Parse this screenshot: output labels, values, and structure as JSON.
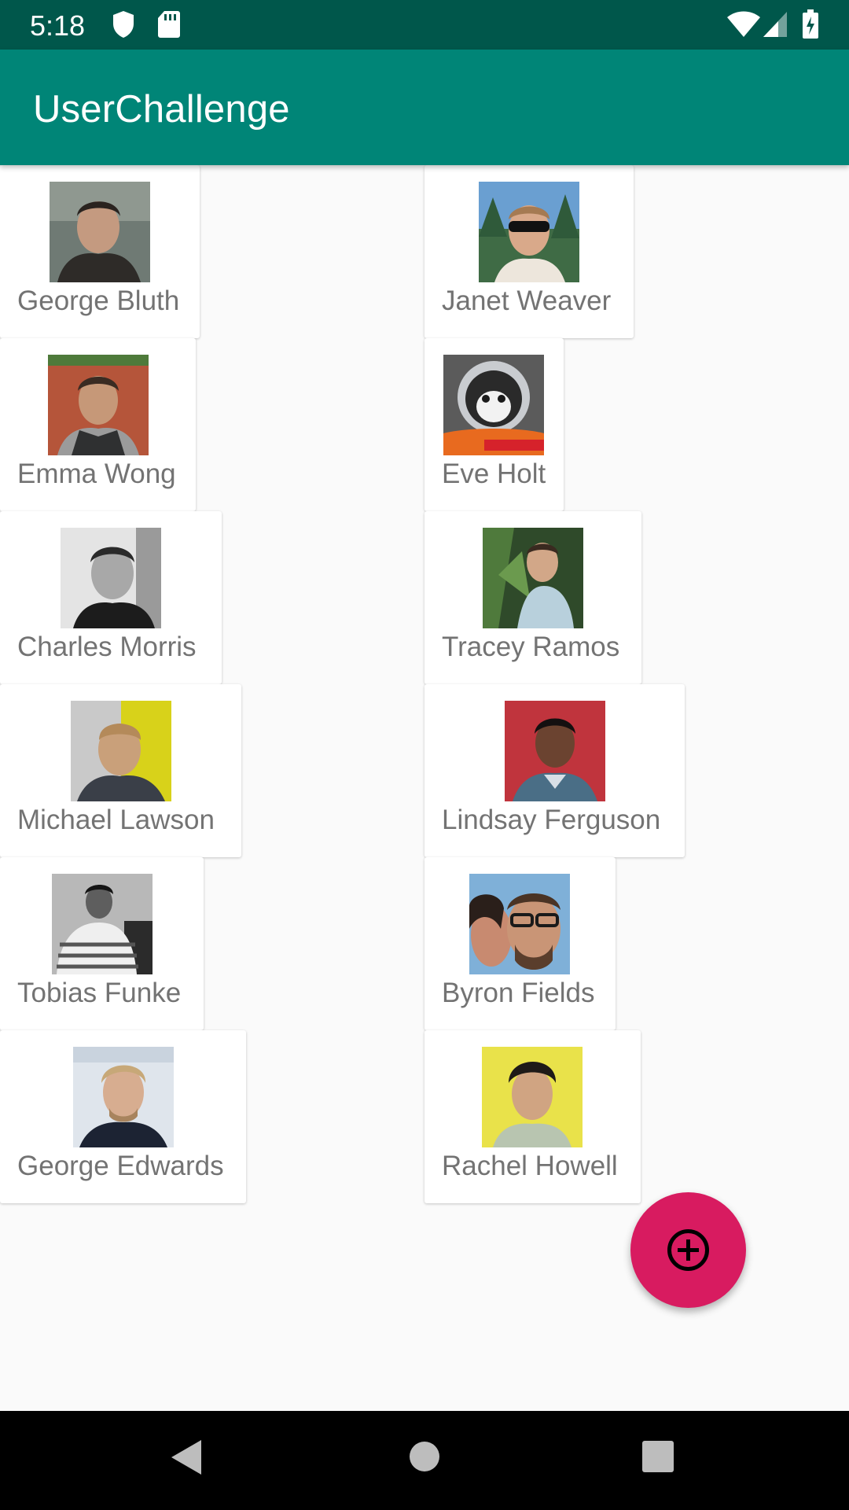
{
  "status_bar": {
    "time": "5:18",
    "icons": [
      "shield-icon",
      "sd-card-icon",
      "wifi-icon",
      "cell-signal-icon",
      "battery-charging-icon"
    ],
    "background": "#00574b"
  },
  "app_bar": {
    "title": "UserChallenge",
    "background": "#008577"
  },
  "users": [
    {
      "name": "George Bluth"
    },
    {
      "name": "Janet Weaver"
    },
    {
      "name": "Emma Wong"
    },
    {
      "name": "Eve Holt"
    },
    {
      "name": "Charles Morris"
    },
    {
      "name": "Tracey Ramos"
    },
    {
      "name": "Michael Lawson"
    },
    {
      "name": "Lindsay Ferguson"
    },
    {
      "name": "Tobias Funke"
    },
    {
      "name": "Byron Fields"
    },
    {
      "name": "George Edwards"
    },
    {
      "name": "Rachel Howell"
    }
  ],
  "fab": {
    "icon": "add-circle-icon",
    "color": "#d81b60"
  },
  "nav_bar": {
    "icons": [
      "back-icon",
      "home-icon",
      "recents-icon"
    ]
  }
}
